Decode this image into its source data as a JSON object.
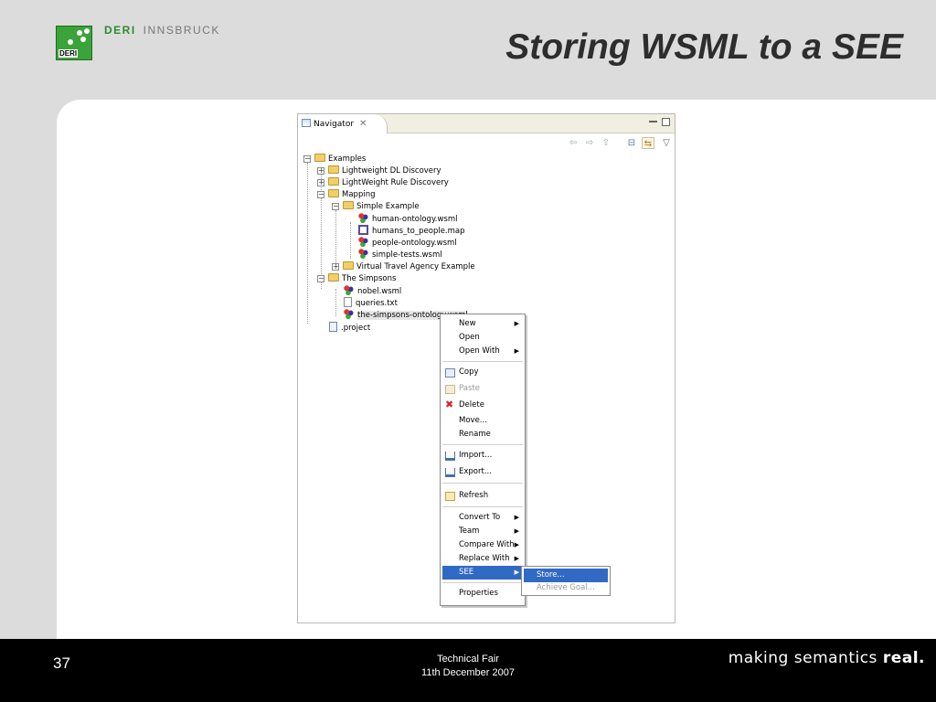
{
  "header": {
    "logo_text": "DERI",
    "org_primary": "DERI",
    "org_secondary": "INNSBRUCK",
    "title": "Storing WSML to a SEE"
  },
  "footer": {
    "page_number": "37",
    "event_name": "Technical Fair",
    "event_date": "11th December 2007",
    "tagline_prefix": "making semantics",
    "tagline_emph": "real."
  },
  "navigator": {
    "tab_label": "Navigator",
    "tree": [
      {
        "label": "Examples",
        "kind": "project",
        "expanded": true
      },
      {
        "label": "Lightweight DL Discovery",
        "kind": "folder",
        "expanded": false
      },
      {
        "label": "LightWeight Rule Discovery",
        "kind": "folder",
        "expanded": false
      },
      {
        "label": "Mapping",
        "kind": "folder",
        "expanded": true
      },
      {
        "label": "Simple Example",
        "kind": "folder",
        "expanded": true
      },
      {
        "label": "human-ontology.wsml",
        "kind": "wsml"
      },
      {
        "label": "humans_to_people.map",
        "kind": "map"
      },
      {
        "label": "people-ontology.wsml",
        "kind": "wsml"
      },
      {
        "label": "simple-tests.wsml",
        "kind": "wsml"
      },
      {
        "label": "Virtual Travel Agency Example",
        "kind": "folder",
        "expanded": false
      },
      {
        "label": "The Simpsons",
        "kind": "folder",
        "expanded": true
      },
      {
        "label": "nobel.wsml",
        "kind": "wsml"
      },
      {
        "label": "queries.txt",
        "kind": "text"
      },
      {
        "label": "the-simpsons-ontology.wsml",
        "kind": "wsml",
        "selected": true
      },
      {
        "label": ".project",
        "kind": "project-file"
      }
    ]
  },
  "context_menu": {
    "items": [
      {
        "label": "New",
        "submenu": true
      },
      {
        "label": "Open"
      },
      {
        "label": "Open With",
        "submenu": true
      },
      {
        "label": "Copy",
        "icon": "copy-icon"
      },
      {
        "label": "Paste",
        "icon": "paste-icon",
        "disabled": true
      },
      {
        "label": "Delete",
        "icon": "delete-icon"
      },
      {
        "label": "Move..."
      },
      {
        "label": "Rename"
      },
      {
        "label": "Import...",
        "icon": "import-icon"
      },
      {
        "label": "Export...",
        "icon": "export-icon"
      },
      {
        "label": "Refresh",
        "icon": "refresh-icon"
      },
      {
        "label": "Convert To",
        "submenu": true
      },
      {
        "label": "Team",
        "submenu": true
      },
      {
        "label": "Compare With",
        "submenu": true
      },
      {
        "label": "Replace With",
        "submenu": true
      },
      {
        "label": "SEE",
        "submenu": true,
        "highlighted": true
      },
      {
        "label": "Properties"
      }
    ]
  },
  "see_submenu": {
    "items": [
      {
        "label": "Store...",
        "highlighted": true
      },
      {
        "label": "Achieve Goal...",
        "disabled": true
      }
    ]
  },
  "colors": {
    "selection": "#316ac5",
    "background": "#dcdcdc",
    "brand_green": "#3aa339"
  }
}
